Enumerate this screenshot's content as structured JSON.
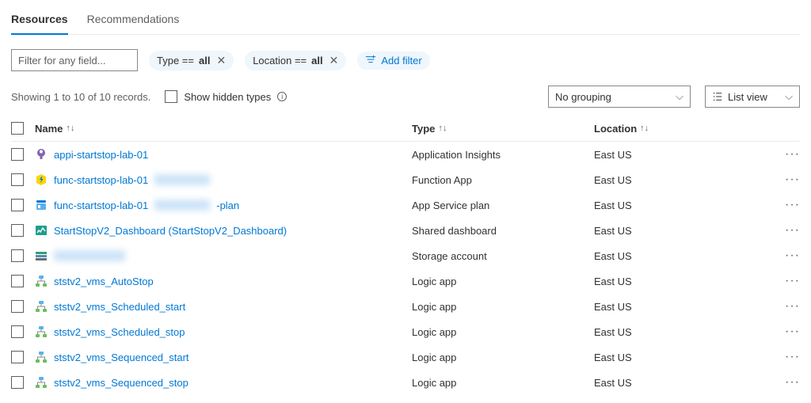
{
  "tabs": {
    "resources": "Resources",
    "recommendations": "Recommendations"
  },
  "toolbar": {
    "filter_placeholder": "Filter for any field...",
    "type_label": "Type == ",
    "type_value": "all",
    "location_label": "Location == ",
    "location_value": "all",
    "add_filter": "Add filter"
  },
  "meta": {
    "records": "Showing 1 to 10 of 10 records.",
    "hidden_types": "Show hidden types",
    "grouping": "No grouping",
    "view": "List view"
  },
  "columns": {
    "name": "Name",
    "type": "Type",
    "location": "Location"
  },
  "rows": [
    {
      "icon": "insights",
      "name": "appi-startstop-lab-01",
      "obscured": false,
      "type": "Application Insights",
      "location": "East US"
    },
    {
      "icon": "function",
      "name": "func-startstop-lab-01",
      "obscured": true,
      "suffix": "",
      "type": "Function App",
      "location": "East US"
    },
    {
      "icon": "appservice",
      "name": "func-startstop-lab-01",
      "obscured": true,
      "suffix": "-plan",
      "type": "App Service plan",
      "location": "East US"
    },
    {
      "icon": "dashboard",
      "name": "StartStopV2_Dashboard (StartStopV2_Dashboard)",
      "obscured": false,
      "type": "Shared dashboard",
      "location": "East US"
    },
    {
      "icon": "storage",
      "name": "",
      "obscured": true,
      "nameHidden": true,
      "type": "Storage account",
      "location": "East US"
    },
    {
      "icon": "logic",
      "name": "ststv2_vms_AutoStop",
      "obscured": false,
      "type": "Logic app",
      "location": "East US"
    },
    {
      "icon": "logic",
      "name": "ststv2_vms_Scheduled_start",
      "obscured": false,
      "type": "Logic app",
      "location": "East US"
    },
    {
      "icon": "logic",
      "name": "ststv2_vms_Scheduled_stop",
      "obscured": false,
      "type": "Logic app",
      "location": "East US"
    },
    {
      "icon": "logic",
      "name": "ststv2_vms_Sequenced_start",
      "obscured": false,
      "type": "Logic app",
      "location": "East US"
    },
    {
      "icon": "logic",
      "name": "ststv2_vms_Sequenced_stop",
      "obscured": false,
      "type": "Logic app",
      "location": "East US"
    }
  ]
}
